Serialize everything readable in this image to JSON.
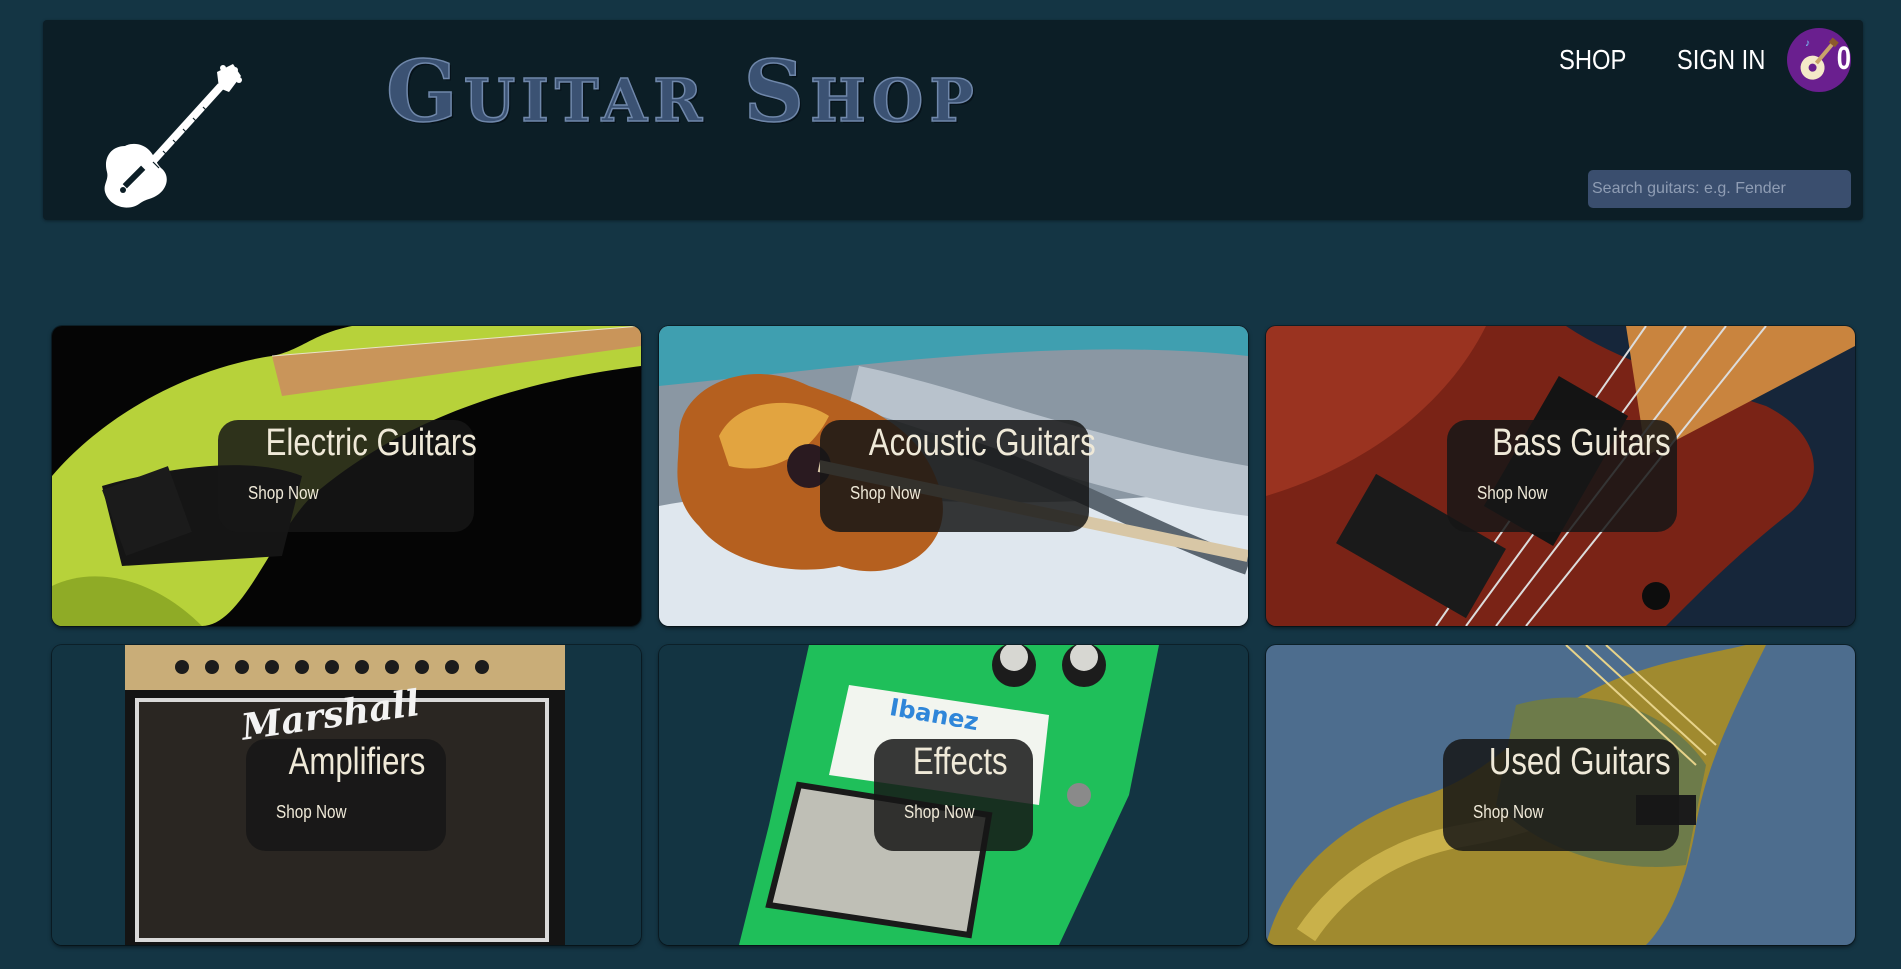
{
  "header": {
    "title": "Guitar Shop",
    "nav": {
      "shop": "SHOP",
      "sign_in": "SIGN IN"
    },
    "cart_count": "0",
    "search_placeholder": "Search guitars: e.g. Fender"
  },
  "categories": [
    {
      "title": "Electric Guitars",
      "cta": "Shop Now",
      "icon": "electric-guitar-image"
    },
    {
      "title": "Acoustic Guitars",
      "cta": "Shop Now",
      "icon": "acoustic-guitar-image"
    },
    {
      "title": "Bass Guitars",
      "cta": "Shop Now",
      "icon": "bass-guitar-image"
    },
    {
      "title": "Amplifiers",
      "cta": "Shop Now",
      "icon": "amplifier-image"
    },
    {
      "title": "Effects",
      "cta": "Shop Now",
      "icon": "effects-pedal-image"
    },
    {
      "title": "Used Guitars",
      "cta": "Shop Now",
      "icon": "used-guitar-image"
    }
  ],
  "colors": {
    "page_bg": "#143544",
    "header_bg": "#0c1e26",
    "title": "#3b5273",
    "cart_badge": "#6a1f8f",
    "overlay_text": "#efe9d8"
  }
}
